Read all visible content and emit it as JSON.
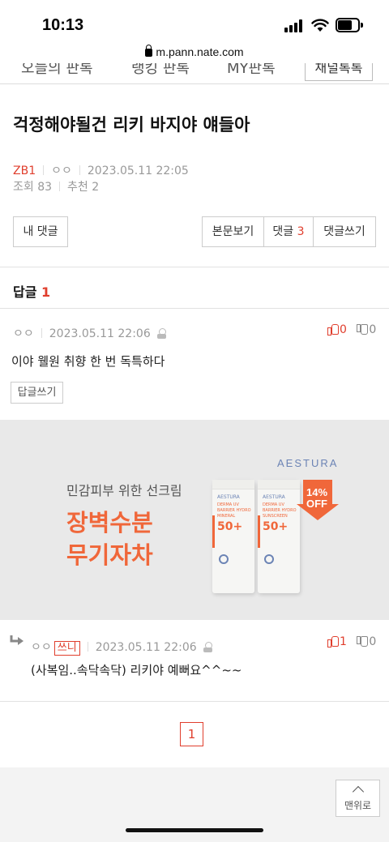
{
  "status_bar": {
    "time": "10:13"
  },
  "browser": {
    "url": "m.pann.nate.com"
  },
  "tabs": [
    "오늘의 판톡",
    "랭킹 판톡",
    "MY판톡",
    "채널톡톡"
  ],
  "post": {
    "title": "걱정해야될건 리키 바지야 얘들아",
    "author": "ZB1",
    "nickname": "ㅇㅇ",
    "date": "2023.05.11 22:05",
    "views_label": "조회 83",
    "recommend_label": "추천 2"
  },
  "buttons": {
    "my_comments": "내 댓글",
    "view_post": "본문보기",
    "comments_label": "댓글",
    "comments_count": "3",
    "write_comment": "댓글쓰기"
  },
  "replies_header": {
    "label": "답글",
    "count": "1"
  },
  "comment1": {
    "nick": "ㅇㅇ",
    "date": "2023.05.11 22:06",
    "text": "이야 웰원 취향 한 번 독특하다",
    "up": "0",
    "down": "0",
    "reply_button": "답글쓰기"
  },
  "ad": {
    "subtitle": "민감피부 위한 선크림",
    "headline1": "장벽수분",
    "headline2": "무기자차",
    "brand": "AESTURA",
    "tube_brand": "AESTURA",
    "tube_line1": "DERMA UV",
    "tube_line2": "BARRIER HYDRO",
    "tube_line3": "MINERAL",
    "tube_line4": "SUNSCREEN",
    "tube_spf": "50+",
    "badge_pct": "14%",
    "badge_off": "OFF",
    "colors": {
      "accent": "#f0673a",
      "brand": "#6c84b5"
    }
  },
  "comment2": {
    "nick": "ㅇㅇ",
    "badge": "쓰니",
    "date": "2023.05.11 22:06",
    "text": "(사복임..속닥속닥) 리키야 예뻐요^^~~",
    "up": "1",
    "down": "0"
  },
  "pagination": {
    "current": "1"
  },
  "scroll_top": {
    "label": "맨위로"
  },
  "colors": {
    "red": "#e03e2d"
  }
}
